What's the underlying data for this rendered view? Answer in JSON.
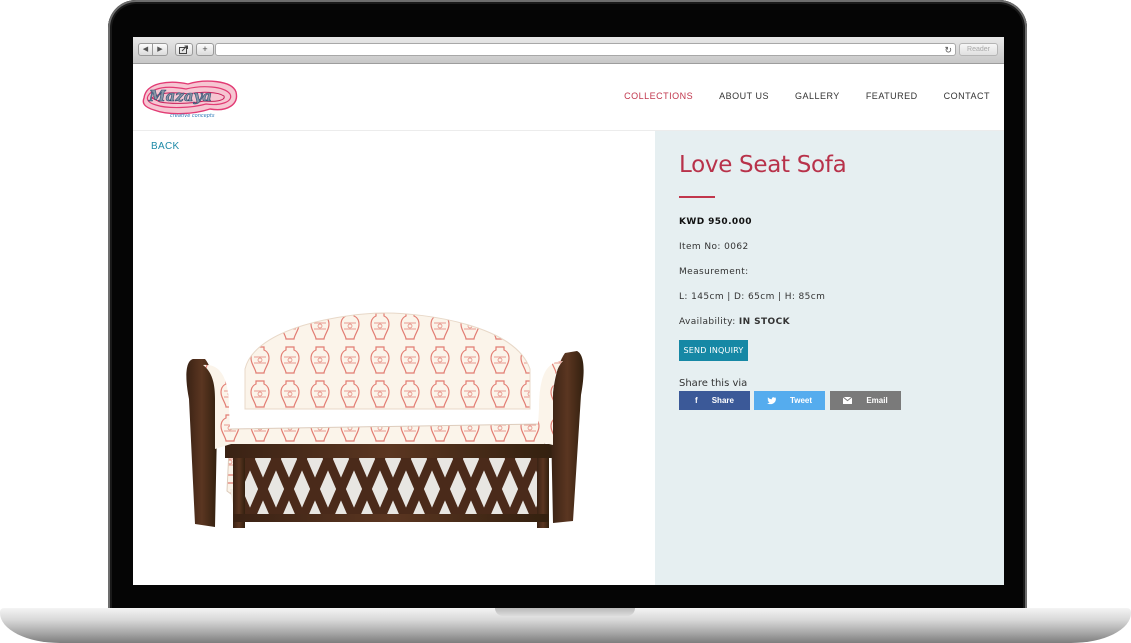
{
  "browser": {
    "reader_label": "Reader",
    "icons": [
      "back-icon",
      "forward-icon",
      "share-page-icon",
      "new-tab-icon",
      "reload-icon"
    ]
  },
  "site": {
    "logo_text": "Mazaya",
    "logo_tagline": "creative concepts",
    "nav": [
      {
        "label": "COLLECTIONS",
        "active": true
      },
      {
        "label": "ABOUT US",
        "active": false
      },
      {
        "label": "GALLERY",
        "active": false
      },
      {
        "label": "FEATURED",
        "active": false
      },
      {
        "label": "CONTACT",
        "active": false
      }
    ],
    "accent_color": "#c1364c",
    "link_color": "#1e8aa7"
  },
  "product": {
    "back_label": "BACK",
    "title": "Love Seat Sofa",
    "price": "KWD 950.000",
    "item_no": "Item No: 0062",
    "measurement_label": "Measurement:",
    "measurements": "L: 145cm | D: 65cm | H: 85cm",
    "availability_label": "Availability:",
    "availability_value": "IN STOCK",
    "inquiry_button": "SEND INQUIRY",
    "panel_color": "#e6eff1"
  },
  "share": {
    "label": "Share this via",
    "buttons": [
      {
        "label": "Share",
        "icon": "facebook-icon",
        "color": "#3b5998"
      },
      {
        "label": "Tweet",
        "icon": "twitter-icon",
        "color": "#55acee"
      },
      {
        "label": "Email",
        "icon": "email-icon",
        "color": "#7a7a7a"
      }
    ]
  }
}
